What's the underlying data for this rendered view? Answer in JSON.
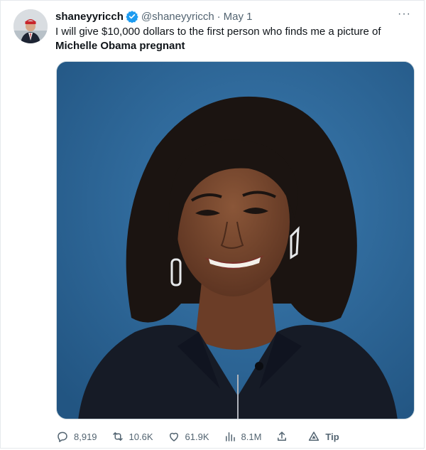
{
  "tweet": {
    "display_name": "shaneyyricch",
    "handle": "@shaneyyricch",
    "separator": "·",
    "date": "May 1",
    "text_line1": "I will give $10,000 dollars to the first person who finds me a picture of",
    "text_line2": "Michelle Obama pregnant",
    "more_label": "···"
  },
  "actions": {
    "replies": "8,919",
    "retweets": "10.6K",
    "likes": "61.9K",
    "views": "8.1M",
    "tip": "Tip"
  },
  "colors": {
    "verified": "#1d9bf0",
    "muted": "#536471",
    "text": "#0f1419",
    "photo_background": "#2f6a9a"
  },
  "icons": [
    "verified-badge-icon",
    "more-icon",
    "reply-icon",
    "retweet-icon",
    "like-icon",
    "views-icon",
    "share-icon",
    "tip-icon"
  ]
}
